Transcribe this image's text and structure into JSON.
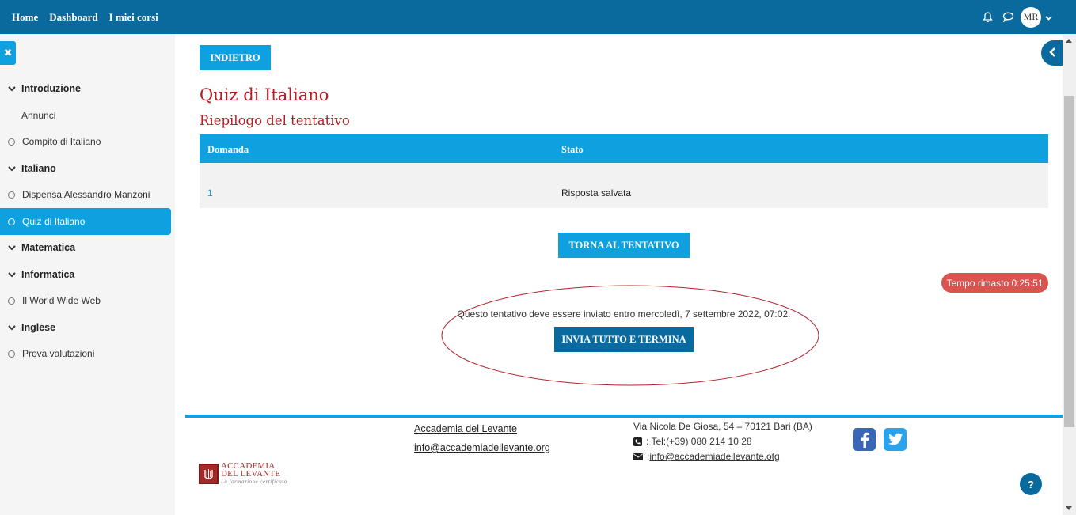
{
  "navbar": {
    "links": [
      "Home",
      "Dashboard",
      "I miei corsi"
    ],
    "avatar_initials": "MR",
    "icons": [
      "bell-icon",
      "chat-icon",
      "chevron-down-icon"
    ]
  },
  "sidebar": {
    "items": [
      {
        "label": "Introduzione",
        "kind": "section"
      },
      {
        "label": "Annunci",
        "kind": "plain"
      },
      {
        "label": "Compito di Italiano",
        "kind": "child"
      },
      {
        "label": "Italiano",
        "kind": "section"
      },
      {
        "label": "Dispensa Alessandro Manzoni",
        "kind": "child"
      },
      {
        "label": "Quiz di Italiano",
        "kind": "child",
        "active": true
      },
      {
        "label": "Matematica",
        "kind": "section"
      },
      {
        "label": "Informatica",
        "kind": "section"
      },
      {
        "label": "Il World Wide Web",
        "kind": "child"
      },
      {
        "label": "Inglese",
        "kind": "section"
      },
      {
        "label": "Prova valutazioni",
        "kind": "child"
      }
    ]
  },
  "main": {
    "back_button": "INDIETRO",
    "title": "Quiz di Italiano",
    "subtitle": "Riepilogo del tentativo",
    "table": {
      "headers": [
        "Domanda",
        "Stato"
      ],
      "rows": [
        [
          "1",
          "Risposta salvata"
        ]
      ]
    },
    "return_button": "TORNA AL TENTATIVO",
    "timer": "Tempo rimasto 0:25:51",
    "notice": "Questo tentativo deve essere inviato entro mercoledì, 7 settembre 2022, 07:02.",
    "submit_button": "INVIA TUTTO E TERMINA"
  },
  "footer": {
    "org_link": "Accademia del Levante",
    "email_link": "info@accademiadellevante.org",
    "address": "Via Nicola De Giosa, 54 – 70121 Bari (BA)",
    "phone_prefix": ": Tel: ",
    "phone": "(+39) 080 214 10 28",
    "email2_prefix": ": ",
    "email2": "info@accademiadellevante.otg",
    "logo_line1": "ACCADEMIA",
    "logo_line2": "DEL LEVANTE",
    "logo_tagline": "La formazione certificata",
    "help": "?"
  },
  "colors": {
    "navbar": "#0a6a9e",
    "accent": "#0fa0e0",
    "title": "#b31d24",
    "timer": "#d9534f"
  }
}
